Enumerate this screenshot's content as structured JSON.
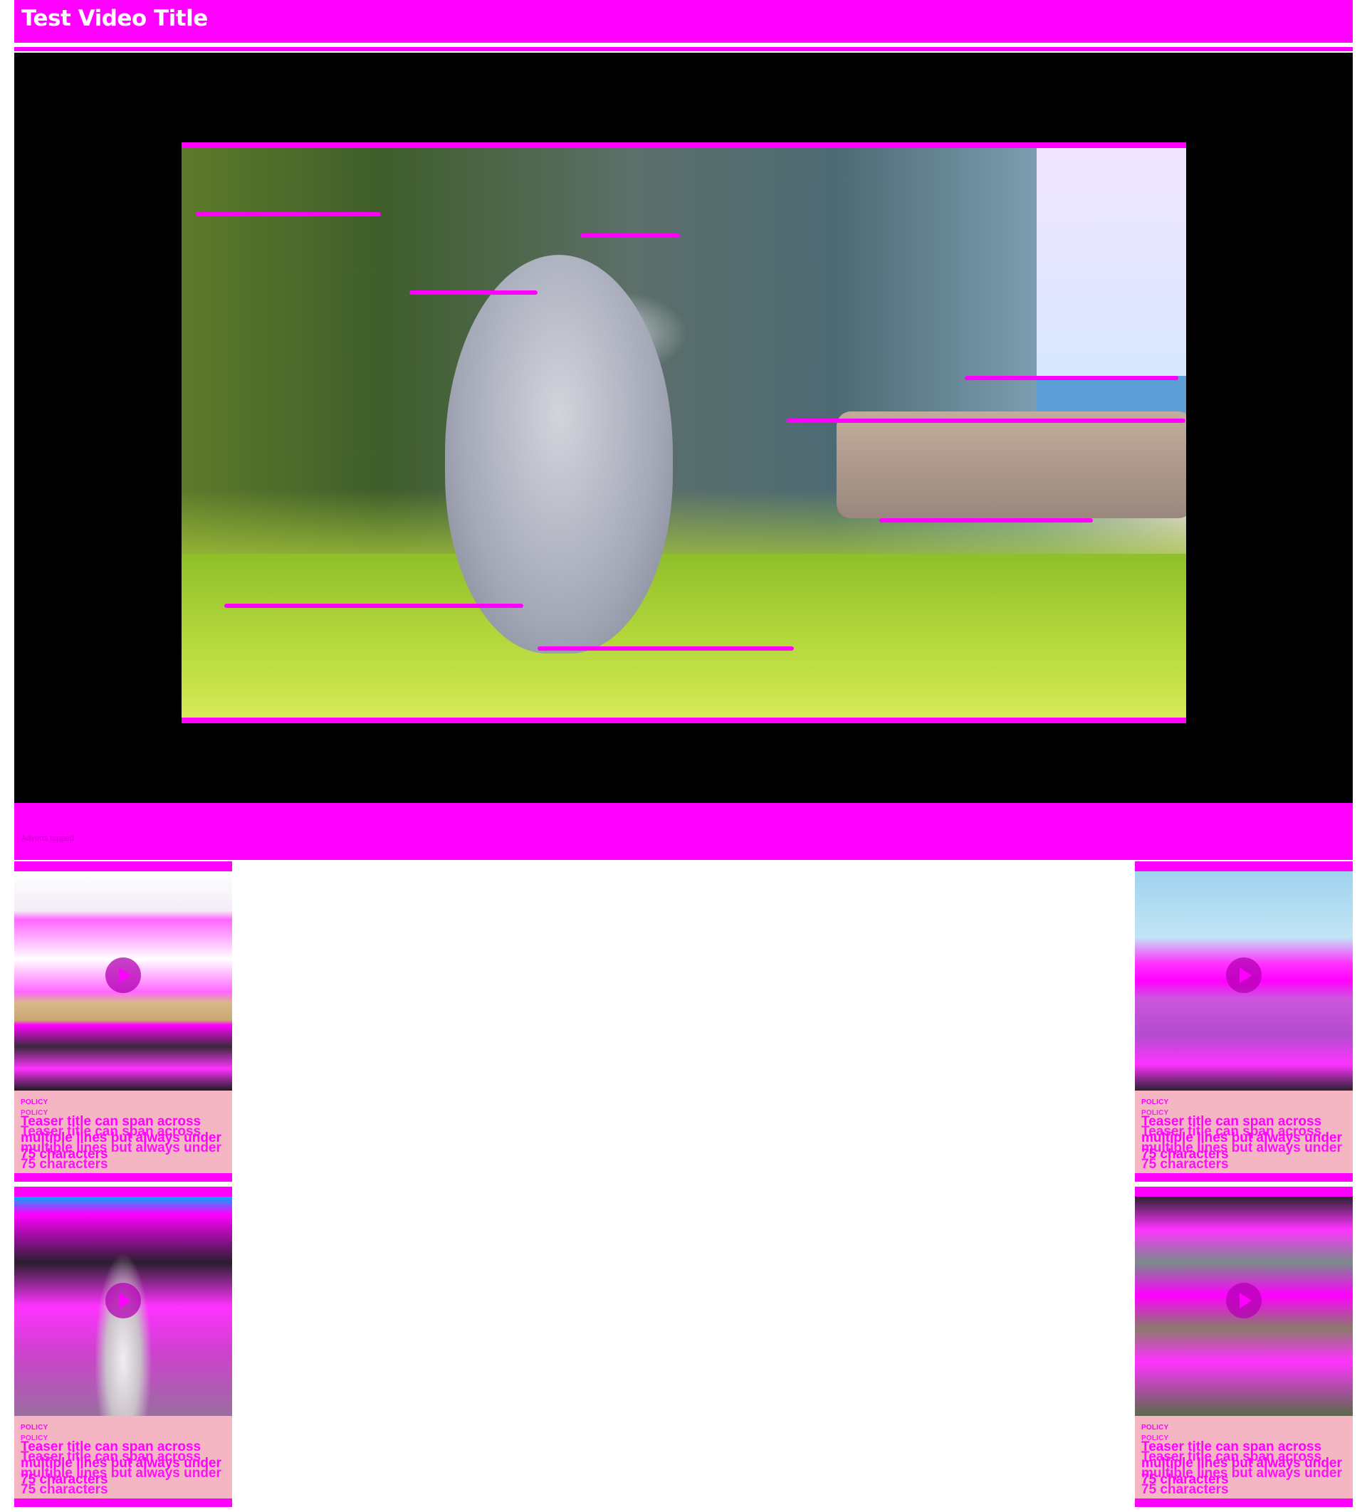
{
  "header": {
    "title": "Test Video Title"
  },
  "player": {
    "controls_label": "Adverts tapped"
  },
  "colors": {
    "accent": "#ff00ff",
    "card_background": "#f4b6c2",
    "player_background": "#000000"
  },
  "cards": [
    {
      "category": "POLICY",
      "category_ghost": "POLICY",
      "title": "Teaser title can span across multiple lines but always under 75 characters",
      "title_ghost": "Teaser title can span across multiple lines but always under 75 characters",
      "icon": "play-icon"
    },
    {
      "category": "POLICY",
      "category_ghost": "POLICY",
      "title": "Teaser title can span across multiple lines but always under 75 characters",
      "title_ghost": "Teaser title can span across multiple lines but always under 75 characters",
      "icon": "play-icon"
    },
    {
      "category": "POLICY",
      "category_ghost": "POLICY",
      "title": "Teaser title can span across multiple lines but always under 75 characters",
      "title_ghost": "Teaser title can span across multiple lines but always under 75 characters",
      "icon": "play-icon"
    },
    {
      "category": "POLICY",
      "category_ghost": "POLICY",
      "title": "Teaser title can span across multiple lines but always under 75 characters",
      "title_ghost": "Teaser title can span across multiple lines but always under 75 characters",
      "icon": "play-icon"
    }
  ]
}
